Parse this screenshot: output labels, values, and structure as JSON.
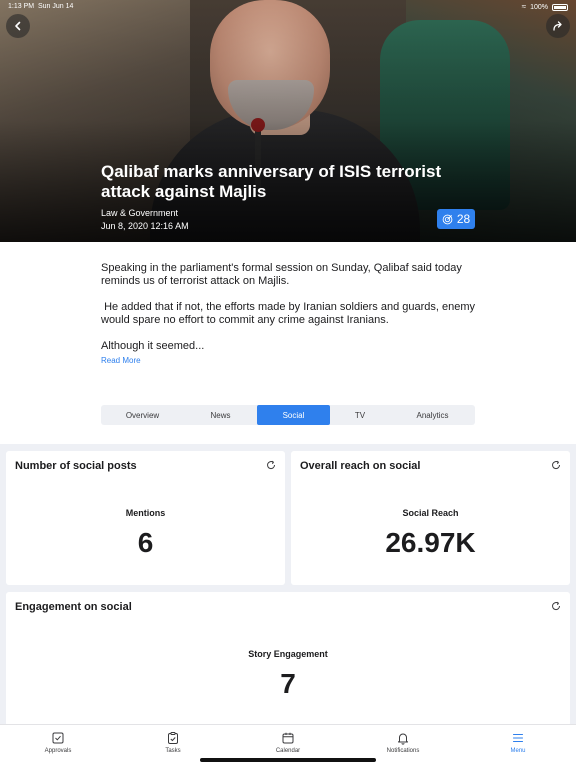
{
  "status_bar": {
    "time": "1:13 PM",
    "date": "Sun Jun 14",
    "battery": "100%"
  },
  "hero": {
    "title": "Qalibaf marks anniversary of ISIS terrorist attack against Majlis",
    "category": "Law & Government",
    "date": "Jun 8, 2020 12:16 AM",
    "score": "28"
  },
  "article": {
    "paragraphs": [
      "Speaking in the parliament's formal session on Sunday, Qalibaf said today reminds us of terrorist attack on Majlis.",
      " He added that if not, the efforts made by Iranian soldiers and guards, enemy would spare no effort to commit any crime against Iranians.",
      "Although it seemed..."
    ],
    "read_more": "Read More"
  },
  "tabs": [
    {
      "label": "Overview",
      "active": false
    },
    {
      "label": "News",
      "active": false
    },
    {
      "label": "Social",
      "active": true
    },
    {
      "label": "TV",
      "active": false
    },
    {
      "label": "Analytics",
      "active": false
    }
  ],
  "cards": {
    "social_posts": {
      "title": "Number of social posts",
      "label": "Mentions",
      "value": "6"
    },
    "reach": {
      "title": "Overall reach on social",
      "label": "Social Reach",
      "value": "26.97K"
    },
    "engagement": {
      "title": "Engagement on social",
      "label": "Story Engagement",
      "value": "7"
    }
  },
  "bottom_nav": [
    {
      "label": "Approvals",
      "icon": "approvals-icon",
      "active": false
    },
    {
      "label": "Tasks",
      "icon": "tasks-icon",
      "active": false
    },
    {
      "label": "Calendar",
      "icon": "calendar-icon",
      "active": false
    },
    {
      "label": "Notifications",
      "icon": "bell-icon",
      "active": false
    },
    {
      "label": "Menu",
      "icon": "menu-icon",
      "active": true
    }
  ],
  "colors": {
    "accent": "#2f80ed",
    "background_cards": "#eef0f5",
    "text": "#1c1c1e"
  }
}
